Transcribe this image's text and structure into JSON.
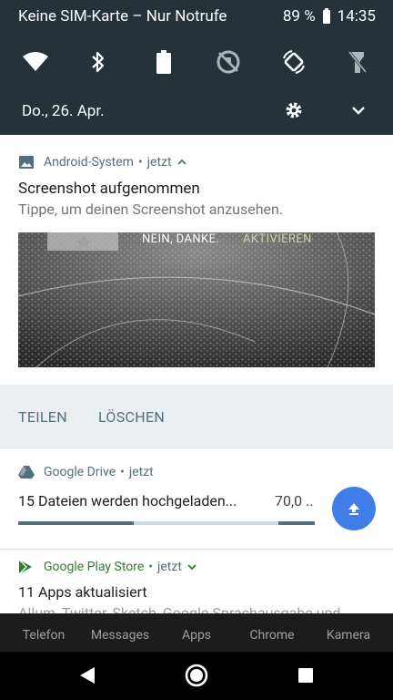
{
  "status_bar": {
    "carrier": "Keine SIM-Karte – Nur Notrufe",
    "battery": "89 %",
    "time": "14:35"
  },
  "quick_settings": {
    "date": "Do., 26. Apr.",
    "tiles": [
      "wifi-icon",
      "bluetooth-icon",
      "battery-saver-icon",
      "data-off-icon",
      "auto-rotate-icon",
      "flashlight-off-icon"
    ]
  },
  "notifications": [
    {
      "app": "Android-System",
      "time": "jetzt",
      "title": "Screenshot aufgenommen",
      "text": "Tippe, um deinen Screenshot anzusehen.",
      "image_overlay": {
        "dismiss": "NEIN, DANKE.",
        "activate": "AKTIVIEREN"
      },
      "actions": [
        "TEILEN",
        "LÖSCHEN"
      ]
    },
    {
      "app": "Google Drive",
      "time": "jetzt",
      "title": "15 Dateien werden hochgeladen...",
      "value": "70,0 ..",
      "progress": 0.39
    },
    {
      "app": "Google Play Store",
      "time": "jetzt",
      "title": "11 Apps aktualisiert",
      "text": "Allum, Twitter, Sketch, Google Sprachausgabe und..."
    }
  ],
  "dock": [
    "Telefon",
    "Messages",
    "Apps",
    "Chrome",
    "Kamera"
  ],
  "colors": {
    "shade": "#263238",
    "fab": "#3f7ee8",
    "play_green": "#2e7d32"
  }
}
